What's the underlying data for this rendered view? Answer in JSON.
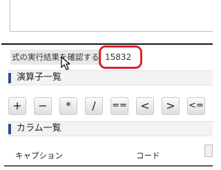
{
  "result": {
    "label": "式の実行結果を確認する",
    "value": "15832",
    "highlight_color": "#d9232d"
  },
  "operators_section": {
    "title": "演算子一覧"
  },
  "operators": [
    "+",
    "−",
    "*",
    "/",
    "==",
    "<",
    ">",
    "<="
  ],
  "columns_section": {
    "title": "カラム一覧"
  },
  "columns_table": {
    "headers": [
      "キャプション",
      "コード"
    ]
  },
  "colors": {
    "section_bar": "#2b4f8a",
    "section_bg": "#f3f3f3"
  },
  "icons": {
    "cursor": "mouse-pointer-icon",
    "section_marker": "blue-bar-icon"
  }
}
